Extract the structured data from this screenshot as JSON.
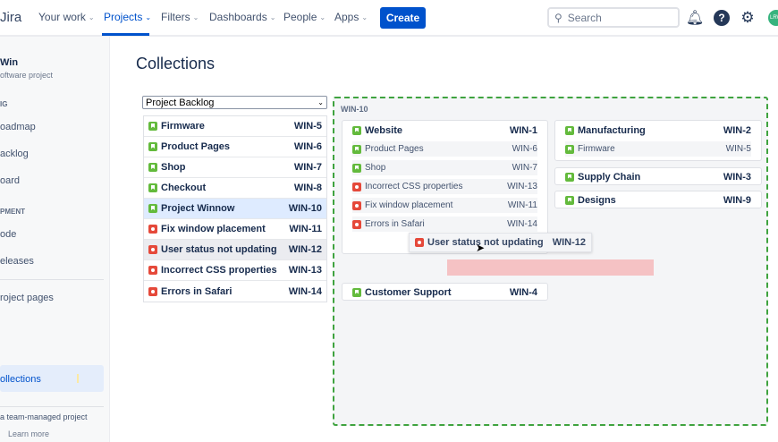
{
  "topbar": {
    "logo": "Jira",
    "nav": [
      {
        "label": "Your work"
      },
      {
        "label": "Projects"
      },
      {
        "label": "Filters"
      },
      {
        "label": "Dashboards"
      },
      {
        "label": "People"
      },
      {
        "label": "Apps"
      }
    ],
    "create": "Create",
    "search_placeholder": "Search",
    "avatar": "LRW"
  },
  "sidebar": {
    "project_name": "Win",
    "project_type": "oftware project",
    "planning_header": "IG",
    "items": [
      {
        "label": "oadmap"
      },
      {
        "label": "acklog"
      },
      {
        "label": "oard"
      }
    ],
    "dev_header": "PMENT",
    "dev_items": [
      {
        "label": "ode"
      },
      {
        "label": "eleases"
      }
    ],
    "project_pages": "roject pages",
    "collections": "ollections",
    "footer": "a team-managed project",
    "learn_more": "Learn more"
  },
  "page": {
    "title": "Collections",
    "select_value": "Project Backlog"
  },
  "backlog": [
    {
      "type": "story",
      "title": "Firmware",
      "key": "WIN-5"
    },
    {
      "type": "story",
      "title": "Product Pages",
      "key": "WIN-6"
    },
    {
      "type": "story",
      "title": "Shop",
      "key": "WIN-7"
    },
    {
      "type": "story",
      "title": "Checkout",
      "key": "WIN-8"
    },
    {
      "type": "story",
      "title": "Project Winnow",
      "key": "WIN-10",
      "state": "selected"
    },
    {
      "type": "bug",
      "title": "Fix window placement",
      "key": "WIN-11"
    },
    {
      "type": "bug",
      "title": "User status not updating",
      "key": "WIN-12",
      "state": "dragging"
    },
    {
      "type": "bug",
      "title": "Incorrect CSS properties",
      "key": "WIN-13"
    },
    {
      "type": "bug",
      "title": "Errors in Safari",
      "key": "WIN-14"
    }
  ],
  "collection": {
    "label": "WIN-10",
    "website": {
      "title": "Website",
      "key": "WIN-1",
      "children": [
        {
          "type": "story",
          "title": "Product Pages",
          "key": "WIN-6"
        },
        {
          "type": "story",
          "title": "Shop",
          "key": "WIN-7"
        },
        {
          "type": "bug",
          "title": "Incorrect CSS properties",
          "key": "WIN-13"
        },
        {
          "type": "bug",
          "title": "Fix window placement",
          "key": "WIN-11"
        },
        {
          "type": "bug",
          "title": "Errors in Safari",
          "key": "WIN-14"
        }
      ]
    },
    "manufacturing": {
      "title": "Manufacturing",
      "key": "WIN-2",
      "children": [
        {
          "type": "story",
          "title": "Firmware",
          "key": "WIN-5"
        }
      ]
    },
    "supply": {
      "title": "Supply Chain",
      "key": "WIN-3"
    },
    "designs": {
      "title": "Designs",
      "key": "WIN-9"
    },
    "support": {
      "title": "Customer Support",
      "key": "WIN-4"
    },
    "ghost": {
      "title": "User status not updating",
      "key": "WIN-12"
    }
  }
}
